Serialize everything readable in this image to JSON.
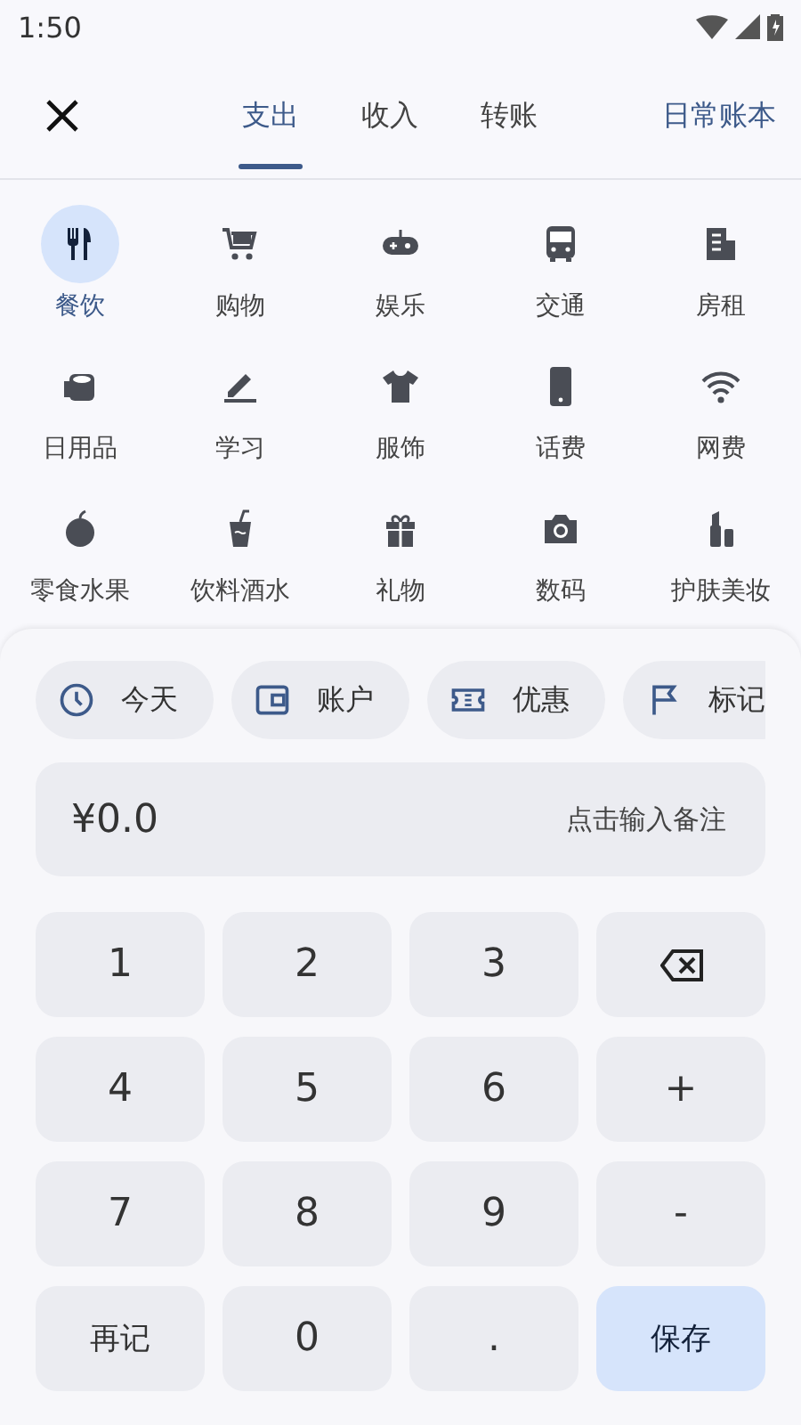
{
  "status_bar": {
    "time": "1:50"
  },
  "header": {
    "tabs": [
      {
        "label": "支出",
        "selected": true
      },
      {
        "label": "收入",
        "selected": false
      },
      {
        "label": "转账",
        "selected": false
      }
    ],
    "book": "日常账本"
  },
  "categories": [
    {
      "label": "餐饮",
      "selected": true
    },
    {
      "label": "购物",
      "selected": false
    },
    {
      "label": "娱乐",
      "selected": false
    },
    {
      "label": "交通",
      "selected": false
    },
    {
      "label": "房租",
      "selected": false
    },
    {
      "label": "日用品",
      "selected": false
    },
    {
      "label": "学习",
      "selected": false
    },
    {
      "label": "服饰",
      "selected": false
    },
    {
      "label": "话费",
      "selected": false
    },
    {
      "label": "网费",
      "selected": false
    },
    {
      "label": "零食水果",
      "selected": false
    },
    {
      "label": "饮料酒水",
      "selected": false
    },
    {
      "label": "礼物",
      "selected": false
    },
    {
      "label": "数码",
      "selected": false
    },
    {
      "label": "护肤美妆",
      "selected": false
    }
  ],
  "chips": [
    {
      "label": "今天"
    },
    {
      "label": "账户"
    },
    {
      "label": "优惠"
    },
    {
      "label": "标记"
    }
  ],
  "amount": {
    "value": "¥0.0",
    "placeholder": "点击输入备注"
  },
  "keys": [
    {
      "kind": "digit",
      "label": "1"
    },
    {
      "kind": "digit",
      "label": "2"
    },
    {
      "kind": "digit",
      "label": "3"
    },
    {
      "kind": "backspace"
    },
    {
      "kind": "digit",
      "label": "4"
    },
    {
      "kind": "digit",
      "label": "5"
    },
    {
      "kind": "digit",
      "label": "6"
    },
    {
      "kind": "action",
      "label": "+"
    },
    {
      "kind": "digit",
      "label": "7"
    },
    {
      "kind": "digit",
      "label": "8"
    },
    {
      "kind": "digit",
      "label": "9"
    },
    {
      "kind": "action",
      "label": "-"
    },
    {
      "kind": "action",
      "label": "再记"
    },
    {
      "kind": "digit",
      "label": "0"
    },
    {
      "kind": "digit",
      "label": "."
    },
    {
      "kind": "save",
      "label": "保存"
    }
  ]
}
